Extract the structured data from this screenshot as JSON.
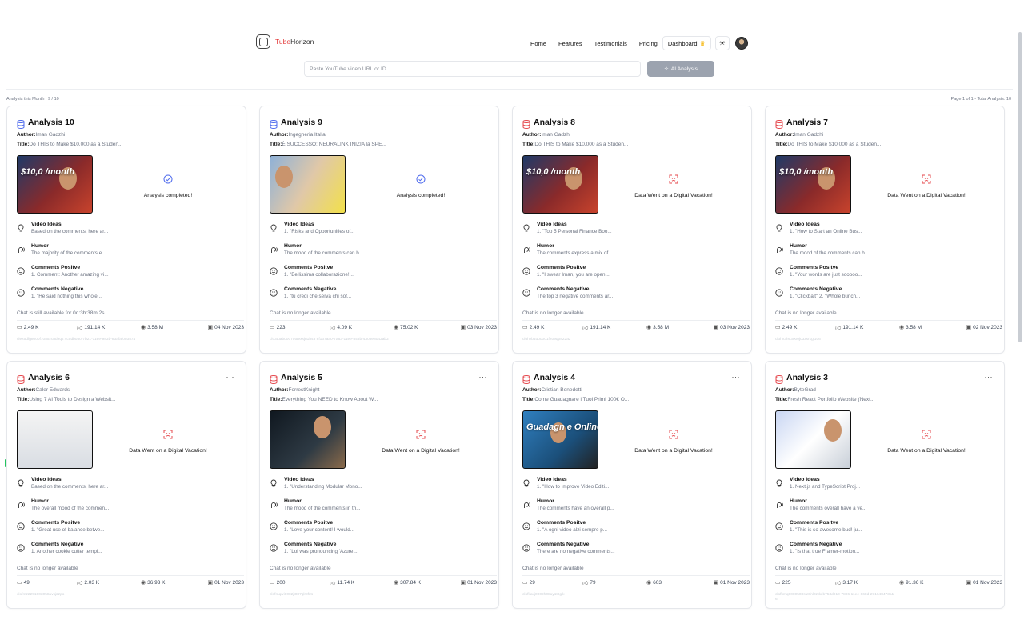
{
  "brand": {
    "part1": "Tube",
    "part2": "Horizon"
  },
  "nav": {
    "home": "Home",
    "features": "Features",
    "testimonials": "Testimonials",
    "pricing": "Pricing",
    "dashboard": "Dashboard"
  },
  "search": {
    "placeholder": "Paste YouTube video URL or ID...",
    "button": "AI Analysis"
  },
  "meta": {
    "left": "Analysis this Month : 9 / 10",
    "right": "Page 1 of 1 - Total Analysis: 10"
  },
  "section_labels": {
    "ideas": "Video Ideas",
    "humor": "Humor",
    "positive": "Comments Positve",
    "negative": "Comments Negative"
  },
  "colors": {
    "completed": "#4f6bed",
    "failed": "#e5484d"
  },
  "cards": [
    {
      "title": "Analysis 10",
      "author_label": "Author:",
      "author": "Iman Gadzhi",
      "title_label": "Title:",
      "video_title": "Do THIS to Make $10,000 as a Studen...",
      "status": "Analysis completed!",
      "status_kind": "completed",
      "icon": "check-circle-icon",
      "thumb_text": "$10,0  /month",
      "ideas": "Based on the comments, here ar...",
      "humor": "The majority of the comments e...",
      "positive": "1. Comment: Another amazing vi...",
      "negative": "1. \"He said nothing this whole...",
      "chat": "Chat is still available for 0d:3h:38m:2s",
      "comments": "2.49 K",
      "likes": "191.14 K",
      "views": "3.58 M",
      "date": "04 Nov 2023",
      "id": "clek5dfg8000f7085zcnd9qs 4c5db080-7b21-11ee-983b-83afaf003574"
    },
    {
      "title": "Analysis 9",
      "author_label": "Author:",
      "author": "Ingegneria Italia",
      "title_label": "Title:",
      "video_title": "È SUCCESSO: NEURALINK INIZIA la SPE...",
      "status": "Analysis completed!",
      "status_kind": "completed",
      "icon": "check-circle-icon",
      "thumb_text": "",
      "ideas": "1. \"Risks and Opportunities of...",
      "humor": "The mood of the comments can b...",
      "positive": "1. \"Bellissima collaborazione!...",
      "negative": "1. \"tu credi che serva chi sof...",
      "chat": "Chat is no longer available",
      "comments": "223",
      "likes": "4.09 K",
      "views": "75.02 K",
      "date": "03 Nov 2023",
      "id": "clo3tuab00070t5exsjn1h43 8f137aa0-7a63-11ee-848b-4308e8042ab2"
    },
    {
      "title": "Analysis 8",
      "author_label": "Author:",
      "author": "Iman Gadzhi",
      "title_label": "Title:",
      "video_title": "Do THIS to Make $10,000 as a Studen...",
      "status": "Data Went on a Digital Vacation!",
      "status_kind": "failed",
      "icon": "broken-frame-icon",
      "thumb_text": "$10,0  /month",
      "ideas": "1. \"Top 5 Personal Finance Boo...",
      "humor": "The comments express a mix of ...",
      "positive": "1. \"I swear Iman, you are open...",
      "negative": "The top 3 negative comments ar...",
      "chat": "Chat is no longer available",
      "comments": "2.49 K",
      "likes": "191.14 K",
      "views": "3.58 M",
      "date": "03 Nov 2023",
      "id": "clohvb4u00001f209qp822az"
    },
    {
      "title": "Analysis 7",
      "author_label": "Author:",
      "author": "Iman Gadzhi",
      "title_label": "Title:",
      "video_title": "Do THIS to Make $10,000 as a Studen...",
      "status": "Data Went on a Digital Vacation!",
      "status_kind": "failed",
      "icon": "broken-frame-icon",
      "thumb_text": "$10,0  /month",
      "ideas": "1. \"How to Start an Online Bus...",
      "humor": "The mood of the comments can b...",
      "positive": "1. \"Your words are just sooooo...",
      "negative": "1. \"Clickbait\" 2. \"Whole bunch...",
      "chat": "Chat is no longer available",
      "comments": "2.49 K",
      "likes": "191.14 K",
      "views": "3.58 M",
      "date": "02 Nov 2023",
      "id": "clohv3h63000j03zsrkgi106"
    },
    {
      "title": "Analysis 6",
      "author_label": "Author:",
      "author": "Caler Edwards",
      "title_label": "Title:",
      "video_title": "Using 7 AI Tools to Design a Websit...",
      "status": "Data Went on a Digital Vacation!",
      "status_kind": "failed",
      "icon": "broken-frame-icon",
      "thumb_text": "",
      "ideas": "Based on the comments, here ar...",
      "humor": "The overall mood of the commen...",
      "positive": "1. \"Great use of balance betwe...",
      "negative": "1. Another cookie cutter templ...",
      "chat": "Chat is no longer available",
      "comments": "49",
      "likes": "2.03 K",
      "views": "36.93 K",
      "date": "01 Nov 2023",
      "id": "clofmz2291003058avsj2zpo"
    },
    {
      "title": "Analysis 5",
      "author_label": "Author:",
      "author": "ForrestKnight",
      "title_label": "Title:",
      "video_title": "Everything You NEED to Know About W...",
      "status": "Data Went on a Digital Vacation!",
      "status_kind": "failed",
      "icon": "broken-frame-icon",
      "thumb_text": "",
      "ideas": "1. \"Understanding Modular Mono...",
      "humor": "The mood of the comments in th...",
      "positive": "1. \"Love your content! I would...",
      "negative": "1. \"Lol was pronouncing 'Azure...",
      "chat": "Chat is no longer available",
      "comments": "200",
      "likes": "11.74 K",
      "views": "307.84 K",
      "date": "01 Nov 2023",
      "id": "clofmqwi9002jt087qlr8f2s"
    },
    {
      "title": "Analysis 4",
      "author_label": "Author:",
      "author": "Cristian Benedetti",
      "title_label": "Title:",
      "video_title": "Come Guadagnare i Tuoi Primi 100€ O...",
      "status": "Data Went on a Digital Vacation!",
      "status_kind": "failed",
      "icon": "broken-frame-icon",
      "thumb_text": "Guadagn  e Online",
      "ideas": "1. \"How to Improve Video Editi...",
      "humor": "The comments have an overall p...",
      "positive": "1. \"A ogni video alzi sempre p...",
      "negative": "There are no negative comments...",
      "chat": "Chat is no longer available",
      "comments": "29",
      "likes": "79",
      "views": "603",
      "date": "01 Nov 2023",
      "id": "clofkaxj0009h08ay1t9glk"
    },
    {
      "title": "Analysis 3",
      "author_label": "Author:",
      "author": "ByteGrad",
      "title_label": "Title:",
      "video_title": "Fresh React Portfolio Website (Next...",
      "status": "Data Went on a Digital Vacation!",
      "status_kind": "failed",
      "icon": "broken-frame-icon",
      "thumb_text": "",
      "ideas": "1. Next.js and TypeScript Proj...",
      "humor": "The comments overall have a ve...",
      "positive": "1. \"This is so awesome bud! ju...",
      "negative": "1. \"Is that true Framer-motion...",
      "chat": "Chat is no longer available",
      "comments": "225",
      "likes": "3.17 K",
      "views": "91.36 K",
      "date": "01 Nov 2023",
      "id": "clofkmq0000508su8fnl0zdx b753d910-7896-11ee-868d-271648473a16"
    }
  ]
}
